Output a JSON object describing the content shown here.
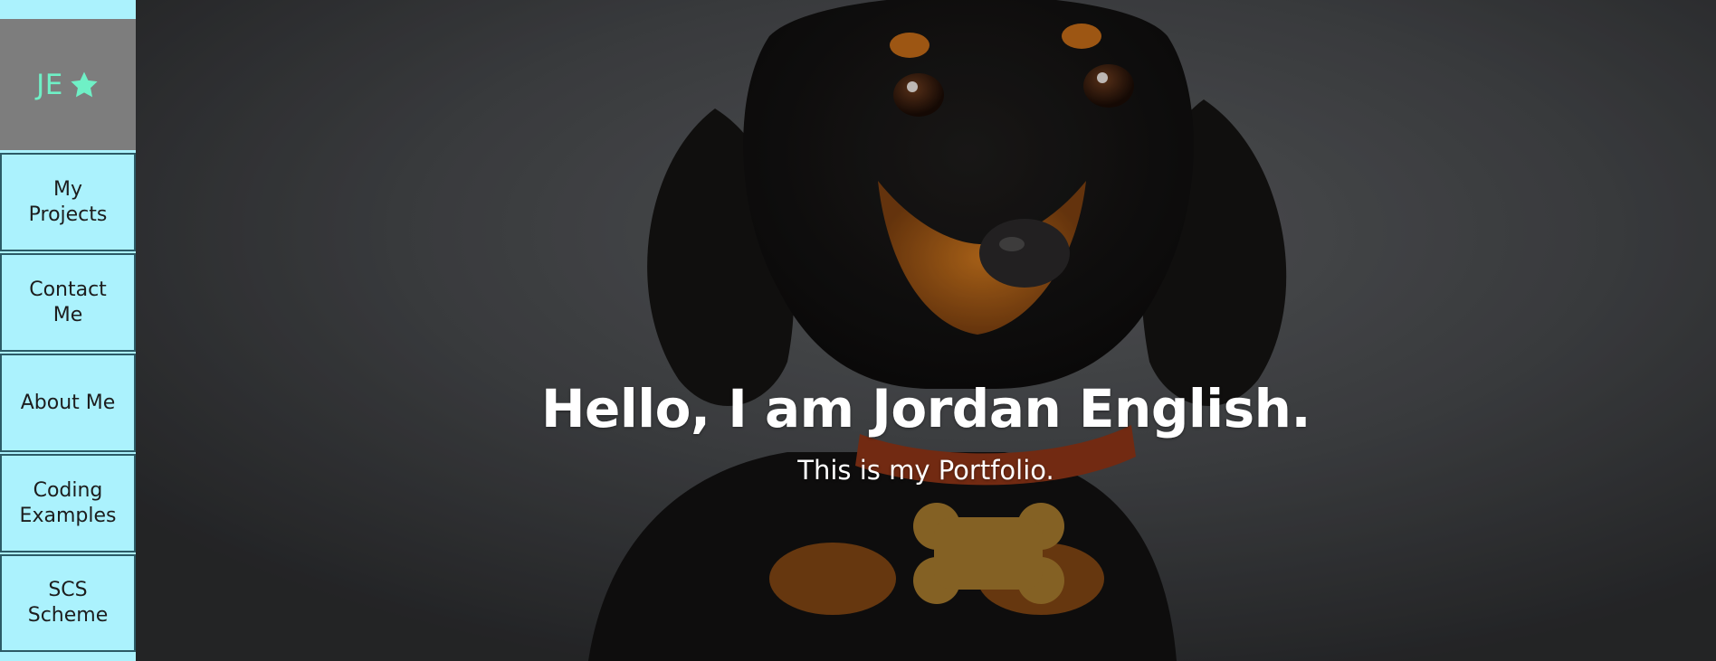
{
  "sidebar": {
    "brand": {
      "initials": "JE",
      "icon": "star-icon"
    },
    "items": [
      {
        "label": "My Projects"
      },
      {
        "label": "Contact Me"
      },
      {
        "label": "About Me"
      },
      {
        "label": "Coding Examples"
      },
      {
        "label": "SCS Scheme"
      }
    ]
  },
  "hero": {
    "title": "Hello, I am Jordan English.",
    "subtitle": "This is my Portfolio.",
    "image": "dachshund-photo"
  },
  "colors": {
    "sidebar_bg": "#abf2fd",
    "brand_bg": "#7d7d7d",
    "brand_accent": "#6ff0c6",
    "nav_border": "#2c5b66",
    "hero_text": "#ffffff"
  }
}
